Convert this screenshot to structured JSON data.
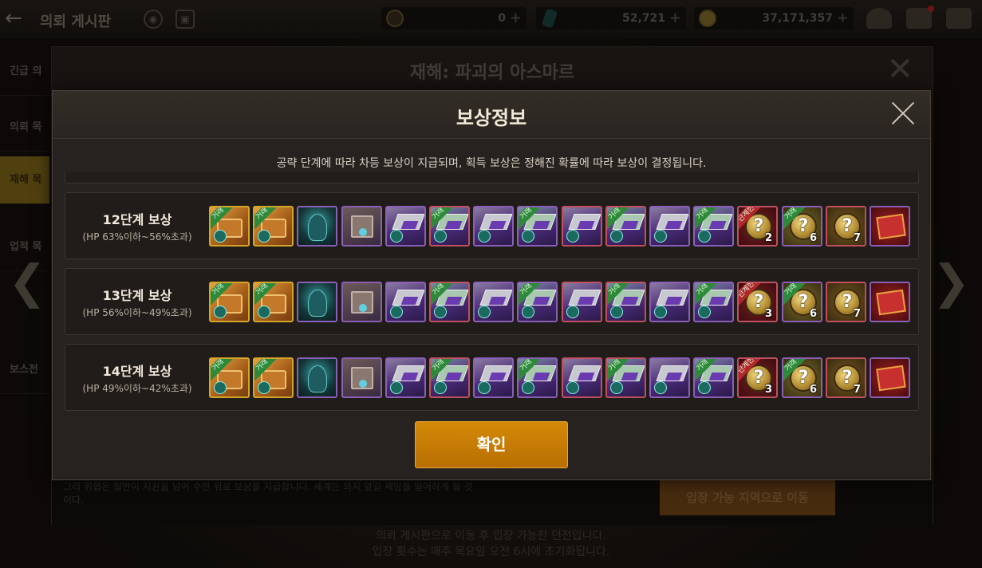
{
  "topbar": {
    "back_icon": "back-arrow-icon",
    "title": "의뢰 게시판",
    "resources": [
      {
        "icon": "moon-currency-icon",
        "value": "0",
        "plus": "+"
      },
      {
        "icon": "crystal-icon",
        "value": "52,721",
        "plus": "+"
      },
      {
        "icon": "gold-coin-icon",
        "value": "37,171,357",
        "plus": "+"
      }
    ]
  },
  "background": {
    "dialog_title": "재해: 파괴의 아스마르",
    "sidebar_items": [
      "긴급 의",
      "의뢰 목",
      "재해 목",
      "업적 목",
      "보스전"
    ],
    "footer_text": "그리 위협은 일반이 지원을 넘어 수만 위로 보상을 지급합니다. 세계는 의지 앞길 재앙을 일어하게 될 것이다.",
    "move_button": "입장 가능 지역으로 이동",
    "bottom_note_1": "의뢰 게시판으로 이동 후 입장 가능한 던전입니다.",
    "bottom_note_2": "입장 횟수는 매주 목요일 오전 6시에 초기화됩니다."
  },
  "modal": {
    "title": "보상정보",
    "description": "공략 단계에 따라 차등 보상이 지급되며, 획득 보상은 정해진 확률에 따라 보상이 결정됩니다.",
    "confirm_label": "확인",
    "rows": [
      {
        "stage": "12단계 보상",
        "hp_range": "(HP 63%이하~56%초과)",
        "items": [
          {
            "kind": "chest",
            "rarity": "gold",
            "tag": "거래"
          },
          {
            "kind": "chest",
            "rarity": "gold",
            "tag": "거래"
          },
          {
            "kind": "monster",
            "rarity": "purple",
            "tag": ""
          },
          {
            "kind": "box",
            "rarity": "purple",
            "tag": ""
          },
          {
            "kind": "gear-silver",
            "rarity": "purple",
            "tag": ""
          },
          {
            "kind": "gear-green",
            "rarity": "red",
            "tag": "거래"
          },
          {
            "kind": "gear-silver",
            "rarity": "purple",
            "tag": ""
          },
          {
            "kind": "gear-green",
            "rarity": "purple",
            "tag": "거래"
          },
          {
            "kind": "gear-silver",
            "rarity": "red",
            "tag": ""
          },
          {
            "kind": "gear-green",
            "rarity": "red",
            "tag": "거래"
          },
          {
            "kind": "gear-silver",
            "rarity": "purple",
            "tag": ""
          },
          {
            "kind": "gear-green",
            "rarity": "purple",
            "tag": "거래"
          },
          {
            "kind": "q-red",
            "rarity": "red",
            "tag": "단계한",
            "count": "2"
          },
          {
            "kind": "q-gold",
            "rarity": "purple",
            "tag": "거래",
            "count": "6"
          },
          {
            "kind": "q-gold2",
            "rarity": "red",
            "tag": "",
            "count": "7"
          },
          {
            "kind": "red-box",
            "rarity": "purple",
            "tag": ""
          }
        ]
      },
      {
        "stage": "13단계 보상",
        "hp_range": "(HP 56%이하~49%초과)",
        "items": [
          {
            "kind": "chest",
            "rarity": "gold",
            "tag": "거래"
          },
          {
            "kind": "chest",
            "rarity": "gold",
            "tag": "거래"
          },
          {
            "kind": "monster",
            "rarity": "purple",
            "tag": ""
          },
          {
            "kind": "box",
            "rarity": "purple",
            "tag": ""
          },
          {
            "kind": "gear-silver",
            "rarity": "purple",
            "tag": ""
          },
          {
            "kind": "gear-green",
            "rarity": "red",
            "tag": "거래"
          },
          {
            "kind": "gear-silver",
            "rarity": "purple",
            "tag": ""
          },
          {
            "kind": "gear-green",
            "rarity": "purple",
            "tag": "거래"
          },
          {
            "kind": "gear-silver",
            "rarity": "red",
            "tag": ""
          },
          {
            "kind": "gear-green",
            "rarity": "red",
            "tag": "거래"
          },
          {
            "kind": "gear-silver",
            "rarity": "purple",
            "tag": ""
          },
          {
            "kind": "gear-green",
            "rarity": "purple",
            "tag": "거래"
          },
          {
            "kind": "q-red",
            "rarity": "red",
            "tag": "단계한",
            "count": "3"
          },
          {
            "kind": "q-gold",
            "rarity": "purple",
            "tag": "거래",
            "count": "6"
          },
          {
            "kind": "q-gold2",
            "rarity": "red",
            "tag": "",
            "count": "7"
          },
          {
            "kind": "red-box",
            "rarity": "purple",
            "tag": ""
          }
        ]
      },
      {
        "stage": "14단계 보상",
        "hp_range": "(HP 49%이하~42%초과)",
        "items": [
          {
            "kind": "chest",
            "rarity": "gold",
            "tag": "거래"
          },
          {
            "kind": "chest",
            "rarity": "gold",
            "tag": "거래"
          },
          {
            "kind": "monster",
            "rarity": "purple",
            "tag": ""
          },
          {
            "kind": "box",
            "rarity": "purple",
            "tag": ""
          },
          {
            "kind": "gear-silver",
            "rarity": "purple",
            "tag": ""
          },
          {
            "kind": "gear-green",
            "rarity": "red",
            "tag": "거래"
          },
          {
            "kind": "gear-silver",
            "rarity": "purple",
            "tag": ""
          },
          {
            "kind": "gear-green",
            "rarity": "purple",
            "tag": "거래"
          },
          {
            "kind": "gear-silver",
            "rarity": "red",
            "tag": ""
          },
          {
            "kind": "gear-green",
            "rarity": "red",
            "tag": "거래"
          },
          {
            "kind": "gear-silver",
            "rarity": "purple",
            "tag": ""
          },
          {
            "kind": "gear-green",
            "rarity": "purple",
            "tag": "거래"
          },
          {
            "kind": "q-red",
            "rarity": "red",
            "tag": "단계한",
            "count": "3"
          },
          {
            "kind": "q-gold",
            "rarity": "purple",
            "tag": "거래",
            "count": "6"
          },
          {
            "kind": "q-gold2",
            "rarity": "red",
            "tag": "",
            "count": "7"
          },
          {
            "kind": "red-box",
            "rarity": "purple",
            "tag": ""
          }
        ]
      }
    ]
  },
  "colors": {
    "accent": "#d48a08",
    "modal_bg": "#262220",
    "rarity_gold": "#d4a52a",
    "rarity_red": "#c05060",
    "rarity_purple": "#8b5fb8"
  }
}
